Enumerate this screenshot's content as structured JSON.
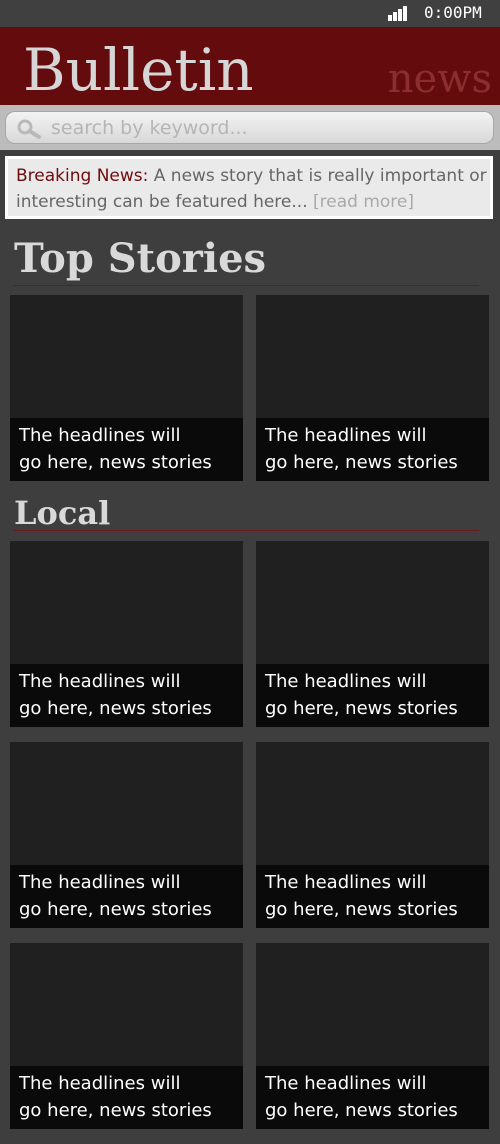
{
  "status_bar": {
    "time": "0:00PM",
    "icons": [
      "signal-bars-icon"
    ]
  },
  "header": {
    "brand": "Bulletin",
    "brand_sub": "news"
  },
  "search": {
    "placeholder": "search by keyword..."
  },
  "breaking": {
    "label": "Breaking News:",
    "text": "A news story that is really important or interesting can be featured here...",
    "more": "[read more]"
  },
  "sections": {
    "top": {
      "title": "Top Stories",
      "cards": [
        {
          "line1": "The headlines will",
          "line2": "go here, news stories"
        },
        {
          "line1": "The headlines will",
          "line2": "go here, news stories"
        }
      ]
    },
    "local": {
      "title": "Local",
      "cards": [
        {
          "line1": "The headlines will",
          "line2": "go here, news stories"
        },
        {
          "line1": "The headlines will",
          "line2": "go here, news stories"
        },
        {
          "line1": "The headlines will",
          "line2": "go here, news stories"
        },
        {
          "line1": "The headlines will",
          "line2": "go here, news stories"
        },
        {
          "line1": "The headlines will",
          "line2": "go here, news stories"
        },
        {
          "line1": "The headlines will",
          "line2": "go here, news stories"
        }
      ]
    }
  },
  "colors": {
    "header_bg": "#640c0d",
    "accent": "#6f0c0c",
    "page_bg": "#3e3e3e",
    "card_bg": "#202020",
    "caption_bg": "#0a0a0a"
  }
}
